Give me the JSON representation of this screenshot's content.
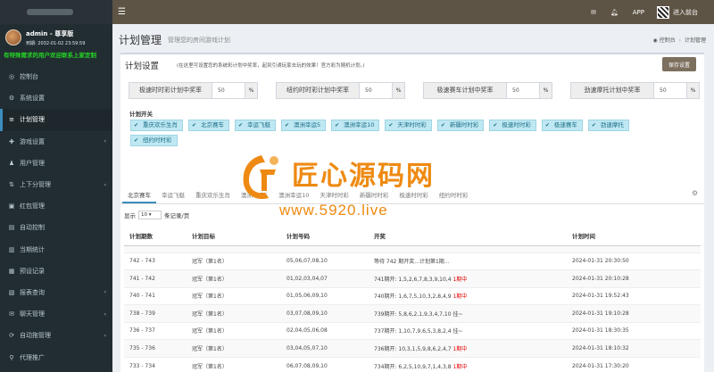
{
  "sidebar": {
    "user": {
      "name": "admin - 尊享版",
      "expire": "到期: 2032-01-02 23:59:59"
    },
    "marquee": "有特殊需求的用户欢迎联系上家定制",
    "items": [
      {
        "label": "控制台",
        "icon": "dashboard-icon",
        "glyph": "◎"
      },
      {
        "label": "系统设置",
        "icon": "gear-icon",
        "glyph": "⚙"
      },
      {
        "label": "计划管理",
        "icon": "list-icon",
        "glyph": "≡"
      },
      {
        "label": "游戏设置",
        "icon": "gamepad-icon",
        "glyph": "✚"
      },
      {
        "label": "用户管理",
        "icon": "users-icon",
        "glyph": "♟"
      },
      {
        "label": "上下分管理",
        "icon": "transfer-icon",
        "glyph": "⇅"
      },
      {
        "label": "红包管理",
        "icon": "gift-icon",
        "glyph": "▣"
      },
      {
        "label": "自动控制",
        "icon": "control-icon",
        "glyph": "▤"
      },
      {
        "label": "当期统计",
        "icon": "chart-icon",
        "glyph": "▥"
      },
      {
        "label": "预设记录",
        "icon": "record-icon",
        "glyph": "▦"
      },
      {
        "label": "报表查询",
        "icon": "report-icon",
        "glyph": "▧"
      },
      {
        "label": "聊天管理",
        "icon": "chat-icon",
        "glyph": "✉"
      },
      {
        "label": "自动拖管理",
        "icon": "robot-icon",
        "glyph": "⟳"
      },
      {
        "label": "代理推广",
        "icon": "share-icon",
        "glyph": "⚲"
      }
    ]
  },
  "topbar": {
    "app": "APP",
    "frontend": "进入前台"
  },
  "header": {
    "title": "计划管理",
    "subtitle": "管理您的房间游戏计划",
    "crumb_home": "控制台",
    "crumb_current": "计划管理"
  },
  "settings": {
    "title": "计划设置",
    "desc": "(在这里可设置您的系统彩计划中奖率，起到引诱玩家去玩的效果！官方彩为随机计划。)",
    "save": "保存设置",
    "rates": [
      {
        "label": "极速时时彩计划中奖率",
        "value": "50",
        "unit": "%"
      },
      {
        "label": "纽约时时彩计划中奖率",
        "value": "50",
        "unit": "%"
      },
      {
        "label": "极速赛车计划中奖率",
        "value": "50",
        "unit": "%"
      },
      {
        "label": "劲速摩托计划中奖率",
        "value": "50",
        "unit": "%"
      }
    ],
    "switch_title": "计划开关",
    "switches": [
      "重庆欢乐生肖",
      "北京赛车",
      "幸运飞艇",
      "澳洲幸运5",
      "澳洲幸运10",
      "天津时时彩",
      "新疆时时彩",
      "极速时时彩",
      "极速赛车",
      "劲速摩托",
      "纽约时时彩"
    ]
  },
  "tabs": [
    "北京赛车",
    "幸运飞艇",
    "重庆欢乐生肖",
    "澳洲幸运5",
    "澳洲幸运10",
    "天津时时彩",
    "新疆时时彩",
    "极速时时彩",
    "纽约时时彩"
  ],
  "table": {
    "show": "显示",
    "per_page": "10",
    "per_page_suffix": "条记录/页",
    "headers": [
      "计划期数",
      "计划目标",
      "计划号码",
      "开奖",
      "计划时间"
    ],
    "rows": [
      {
        "period": "742 - 743",
        "target": "冠军（第1名）",
        "numbers": "05,06,07,08,10",
        "result": "等待 742 期开奖...计划第1期...",
        "hit": "",
        "time": "2024-01-31 20:30:50"
      },
      {
        "period": "741 - 742",
        "target": "冠军（第1名）",
        "numbers": "01,02,03,04,07",
        "result": "741期开: 1,5,2,6,7,8,3,9,10,4",
        "hit": "1期中",
        "time": "2024-01-31 20:10:28"
      },
      {
        "period": "740 - 741",
        "target": "冠军（第1名）",
        "numbers": "01,05,06,09,10",
        "result": "740期开: 1,6,7,5,10,3,2,8,4,9",
        "hit": "1期中",
        "time": "2024-01-31 19:52:43"
      },
      {
        "period": "738 - 739",
        "target": "冠军（第1名）",
        "numbers": "03,07,08,09,10",
        "result": "739期开: 5,8,6,2,1,9,3,4,7,10 挂~",
        "hit": "",
        "time": "2024-01-31 19:10:28"
      },
      {
        "period": "736 - 737",
        "target": "冠军（第1名）",
        "numbers": "02,04,05,06,08",
        "result": "737期开: 1,10,7,9,6,5,3,8,2,4 挂~",
        "hit": "",
        "time": "2024-01-31 18:30:35"
      },
      {
        "period": "735 - 736",
        "target": "冠军（第1名）",
        "numbers": "03,04,05,07,10",
        "result": "736期开: 10,3,1,5,9,8,6,2,4,7",
        "hit": "1期中",
        "time": "2024-01-31 18:10:32"
      },
      {
        "period": "733 - 734",
        "target": "冠军（第1名）",
        "numbers": "06,07,08,09,10",
        "result": "734期开: 6,2,5,10,9,7,1,4,3,8",
        "hit": "1期中",
        "time": "2024-01-31 17:30:20"
      }
    ]
  },
  "watermark": {
    "brand": "匠心源码网",
    "url": "www.5920.live"
  }
}
